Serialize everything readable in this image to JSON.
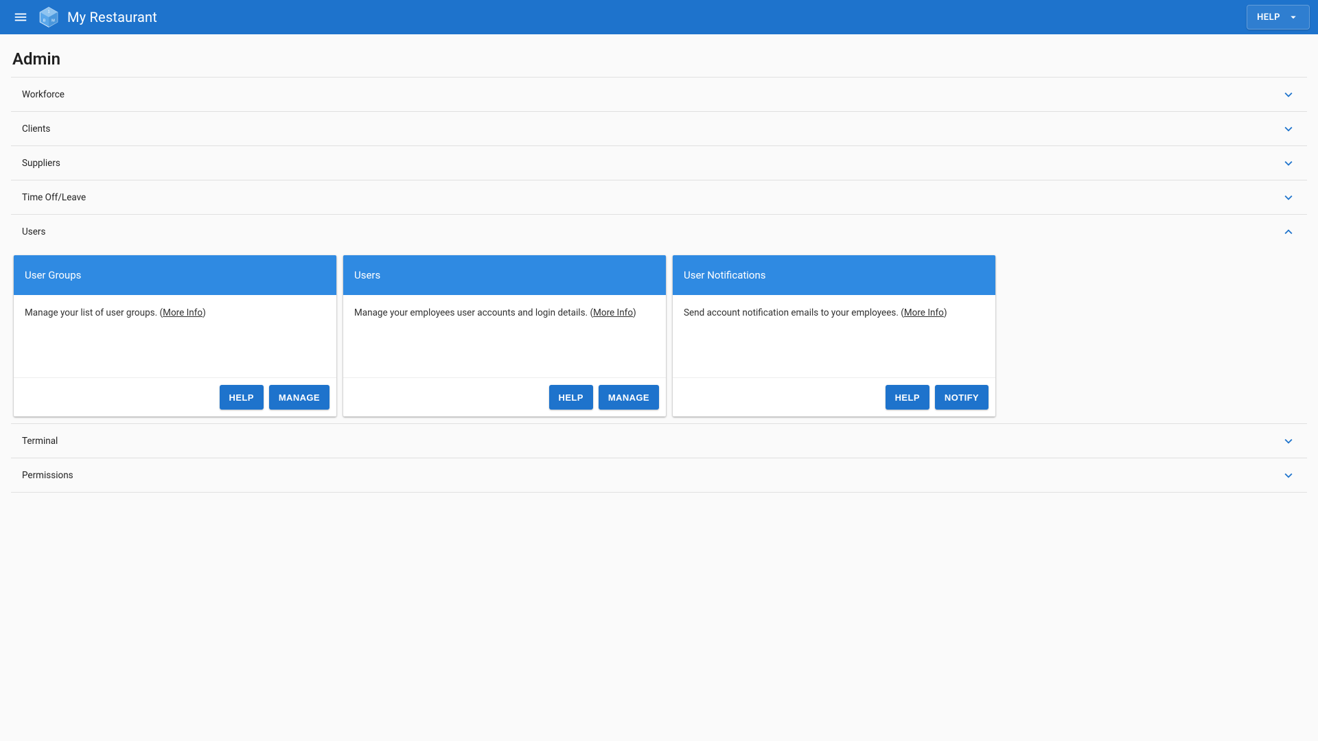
{
  "appbar": {
    "title": "My Restaurant",
    "help_button_label": "HELP"
  },
  "page": {
    "title": "Admin"
  },
  "sections": [
    {
      "label": "Workforce",
      "expanded": false
    },
    {
      "label": "Clients",
      "expanded": false
    },
    {
      "label": "Suppliers",
      "expanded": false
    },
    {
      "label": "Time Off/Leave",
      "expanded": false
    },
    {
      "label": "Users",
      "expanded": true
    },
    {
      "label": "Terminal",
      "expanded": false
    },
    {
      "label": "Permissions",
      "expanded": false
    }
  ],
  "users_cards": [
    {
      "title": "User Groups",
      "description": "Manage your list of user groups. ",
      "more_info_label": "More Info",
      "buttons": [
        {
          "label": "HELP",
          "name": "card-user-groups-help-button"
        },
        {
          "label": "MANAGE",
          "name": "card-user-groups-manage-button"
        }
      ]
    },
    {
      "title": "Users",
      "description": "Manage your employees user accounts and login details. ",
      "more_info_label": "More Info",
      "buttons": [
        {
          "label": "HELP",
          "name": "card-users-help-button"
        },
        {
          "label": "MANAGE",
          "name": "card-users-manage-button"
        }
      ]
    },
    {
      "title": "User Notifications",
      "description": "Send account notification emails to your employees. ",
      "more_info_label": "More Info",
      "buttons": [
        {
          "label": "HELP",
          "name": "card-user-notifications-help-button"
        },
        {
          "label": "NOTIFY",
          "name": "card-user-notifications-notify-button"
        }
      ]
    }
  ]
}
